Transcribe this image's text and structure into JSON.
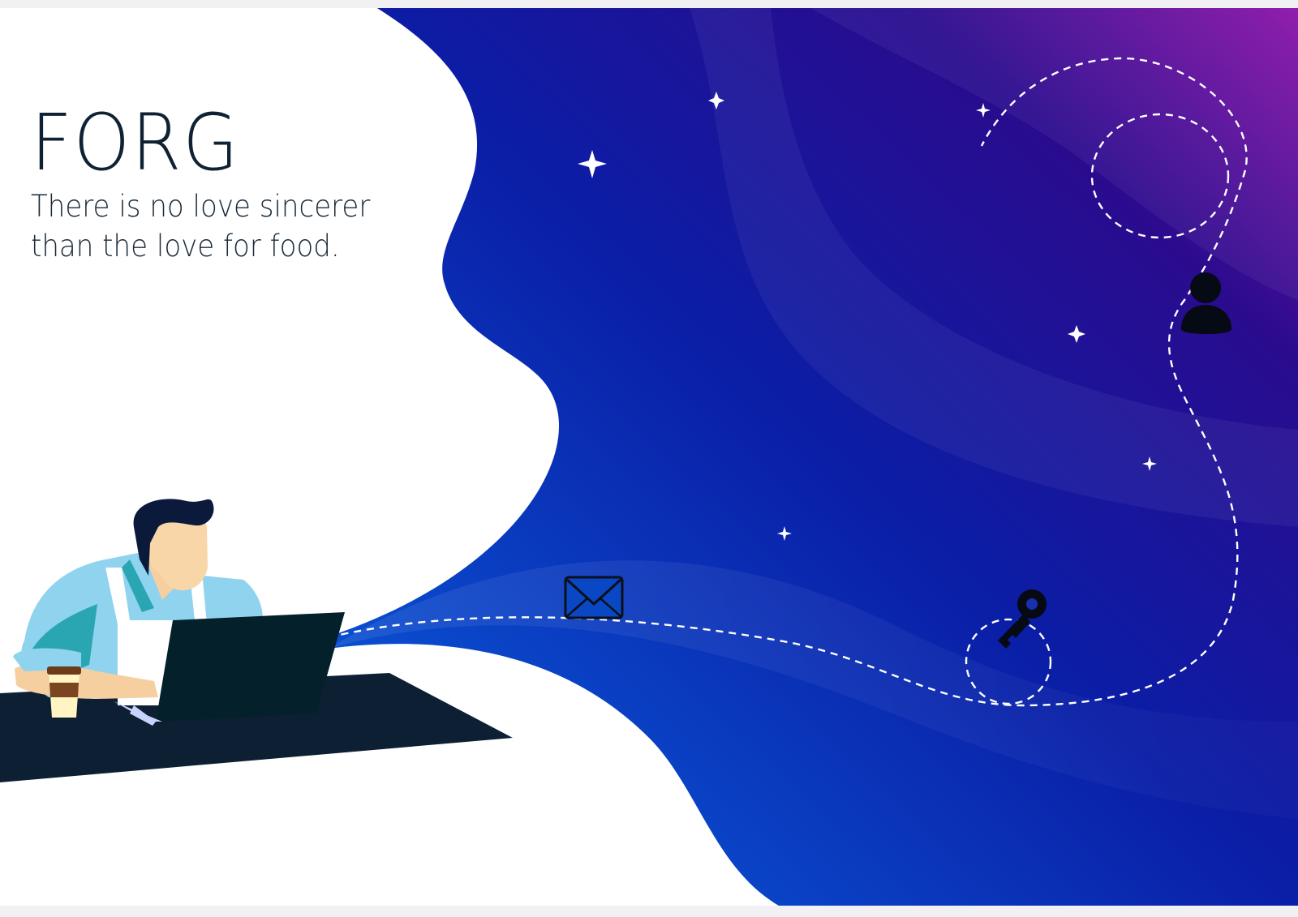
{
  "brand": {
    "title": "FORG",
    "tagline": "There is no love sincerer than the love for food."
  },
  "colors": {
    "text": "#0f2233",
    "wave_start": "#0047c8",
    "wave_mid": "#0a1a9e",
    "wave_end": "#8a12a8",
    "laptop": "#04202a",
    "desk": "#0d2033"
  },
  "icons": {
    "mail": "envelope-icon",
    "key": "key-icon",
    "user": "user-icon",
    "sparkle": "sparkle-icon"
  }
}
